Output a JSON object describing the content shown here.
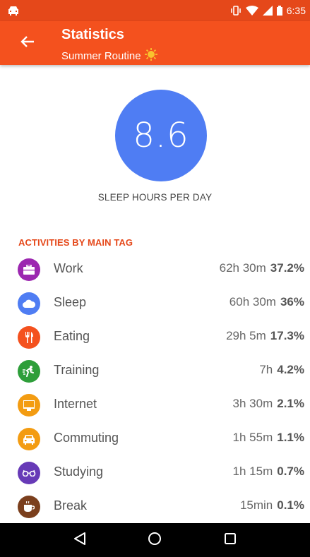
{
  "status_bar": {
    "time": "6:35",
    "icons": [
      "car-icon",
      "vibrate-icon",
      "wifi-icon",
      "signal-icon",
      "battery-icon"
    ]
  },
  "app_bar": {
    "title": "Statistics",
    "subtitle": "Summer Routine",
    "subtitle_icon": "sun-icon",
    "back_icon": "arrow-left-icon"
  },
  "summary": {
    "value": "8.6",
    "label": "SLEEP HOURS PER DAY",
    "color": "#4f7df3"
  },
  "section": {
    "title": "ACTIVITIES BY MAIN TAG"
  },
  "activities": [
    {
      "name": "Work",
      "duration": "62h 30m",
      "percent": "37.2%",
      "color": "#9c27b0",
      "icon": "briefcase-icon"
    },
    {
      "name": "Sleep",
      "duration": "60h 30m",
      "percent": "36%",
      "color": "#4f7df3",
      "icon": "cloud-icon"
    },
    {
      "name": "Eating",
      "duration": "29h 5m",
      "percent": "17.3%",
      "color": "#f4511e",
      "icon": "cutlery-icon"
    },
    {
      "name": "Training",
      "duration": "7h",
      "percent": "4.2%",
      "color": "#2e9e3a",
      "icon": "running-icon"
    },
    {
      "name": "Internet",
      "duration": "3h 30m",
      "percent": "2.1%",
      "color": "#f39c12",
      "icon": "monitor-icon"
    },
    {
      "name": "Commuting",
      "duration": "1h 55m",
      "percent": "1.1%",
      "color": "#f39c12",
      "icon": "car-icon"
    },
    {
      "name": "Studying",
      "duration": "1h 15m",
      "percent": "0.7%",
      "color": "#673ab7",
      "icon": "glasses-icon"
    },
    {
      "name": "Break",
      "duration": "15min",
      "percent": "0.1%",
      "color": "#7b3f1d",
      "icon": "coffee-icon"
    }
  ],
  "nav_bar": {
    "icons": [
      "back-triangle-icon",
      "home-circle-icon",
      "recents-square-icon"
    ]
  },
  "colors": {
    "accent": "#f4511e",
    "status_bar": "#e5481a"
  }
}
